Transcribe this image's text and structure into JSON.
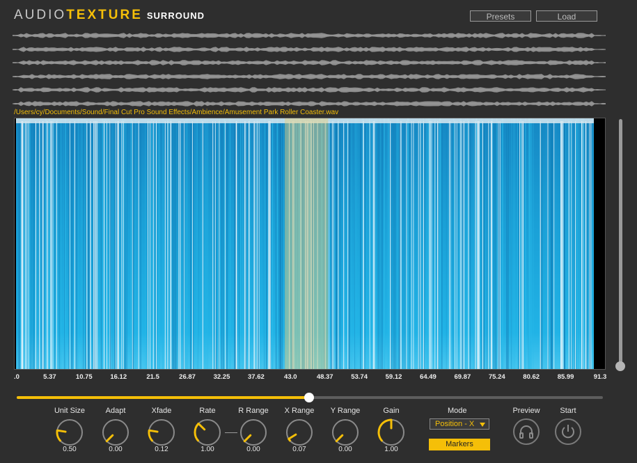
{
  "app": {
    "title_part1": "AUDIO",
    "title_part2": "TEXTURE",
    "title_part3": "SURROUND"
  },
  "toolbar": {
    "presets_label": "Presets",
    "load_label": "Load"
  },
  "file": {
    "path": "/Users/cy/Documents/Sound/Final Cut Pro Sound Effects/Ambience/Amusement Park Roller Coaster.wav"
  },
  "waveform_channels": 6,
  "timeline": {
    "ticks": [
      ".0",
      "5.37",
      "10.75",
      "16.12",
      "21.5",
      "26.87",
      "32.25",
      "37.62",
      "43.0",
      "48.37",
      "53.74",
      "59.12",
      "64.49",
      "69.87",
      "75.24",
      "80.62",
      "85.99",
      "91.3"
    ],
    "selection_start_fraction": 0.465,
    "selection_end_fraction": 0.54,
    "position_fraction": 0.499
  },
  "controls": {
    "knobs": [
      {
        "label": "Unit Size",
        "value": "0.50",
        "level": 0.2
      },
      {
        "label": "Adapt",
        "value": "0.00",
        "level": 0.0
      },
      {
        "label": "Xfade",
        "value": "0.12",
        "level": 0.2
      },
      {
        "label": "Rate",
        "value": "1.00",
        "level": 0.33
      },
      {
        "label": "R Range",
        "value": "0.00",
        "level": 0.0
      },
      {
        "label": "X Range",
        "value": "0.07",
        "level": 0.05
      },
      {
        "label": "Y Range",
        "value": "0.00",
        "level": 0.0
      },
      {
        "label": "Gain",
        "value": "1.00",
        "level": 0.5
      }
    ],
    "mode_label": "Mode",
    "mode_value": "Position - X",
    "markers_label": "Markers",
    "preview_label": "Preview",
    "start_label": "Start"
  },
  "colors": {
    "accent": "#f5bf08",
    "background": "#2e2e2e",
    "spectrogram": "#1ba4d8"
  },
  "icons": {
    "preview": "headphones-icon",
    "start": "power-icon"
  }
}
